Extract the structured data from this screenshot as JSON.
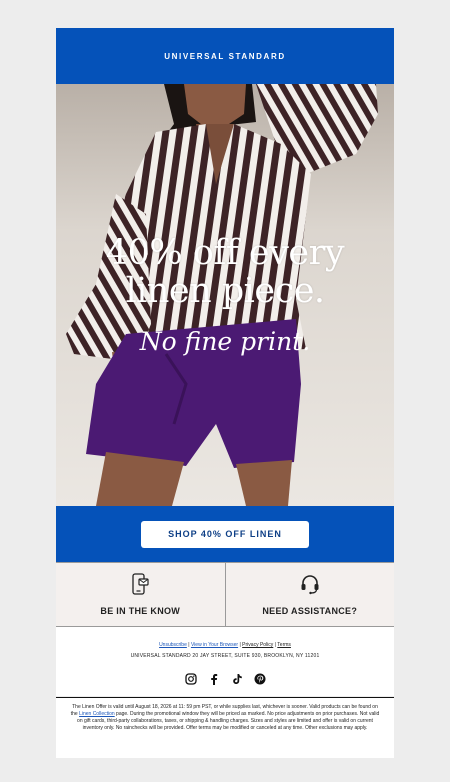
{
  "header": {
    "brand": "UNIVERSAL STANDARD"
  },
  "hero": {
    "headline_line1": "40% off every",
    "headline_line2": "linen piece.",
    "subline": "No fine print."
  },
  "cta": {
    "label": "SHOP 40% OFF LINEN"
  },
  "info": {
    "left_label": "BE IN THE KNOW",
    "right_label": "NEED ASSISTANCE?"
  },
  "footer": {
    "unsubscribe": "Unsubscribe",
    "view_in_browser": "View in Your Browser",
    "privacy_policy": "Privacy Policy",
    "terms": "Terms",
    "separator": " | ",
    "address": "UNIVERSAL STANDARD 20 JAY STREET, SUITE 930, BROOKLYN, NY 11201",
    "social": [
      "instagram-icon",
      "facebook-icon",
      "tiktok-icon",
      "pinterest-icon"
    ]
  },
  "legal": {
    "text_before_link": "The Linen Offer is valid until August 18, 2026 at 11: 59 pm PST, or while supplies last, whichever is sooner. Valid products can be found on the ",
    "link": "Linen Collection",
    "text_after_link": " page. During the promotional window they will be priced as marked. No price adjustments on prior purchases. Not valid on gift cards, third-party collaborations, taxes, or shipping & handling charges. Sizes and styles are limited and offer is valid on current inventory only. No rainchecks will be provided. Offer terms may be modified or canceled at any time. Other exclusions may apply."
  },
  "colors": {
    "brand_blue": "#0552b9",
    "cta_text": "#0e3f86",
    "skirt_purple": "#4b1a73",
    "stripe_brown": "#3d2326"
  }
}
